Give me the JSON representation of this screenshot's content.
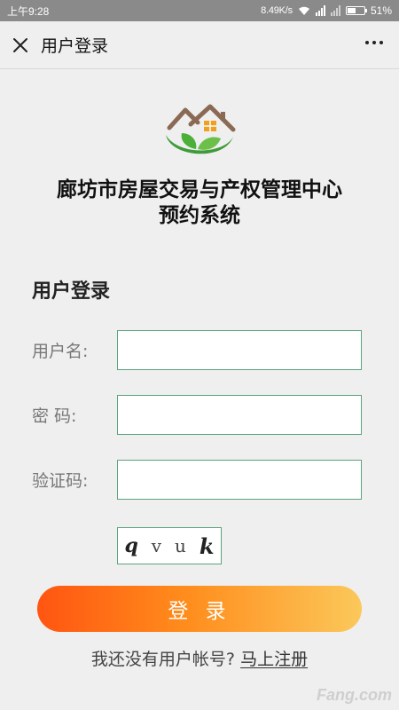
{
  "status_bar": {
    "time": "上午9:28",
    "network_speed": "8.49K/s",
    "battery_percent": "51%",
    "battery_level": 0.51
  },
  "title_bar": {
    "title": "用户登录",
    "close_icon": "close-icon",
    "more_icon": "more-dots-icon"
  },
  "app": {
    "title_line1": "廊坊市房屋交易与产权管理中心",
    "title_line2": "预约系统"
  },
  "login_form": {
    "heading": "用户登录",
    "username_label": "用户名:",
    "username_value": "",
    "password_label": "密 码:",
    "password_value": "",
    "captcha_label": "验证码:",
    "captcha_value": "",
    "captcha_chars": [
      "q",
      "v",
      "u",
      "k"
    ],
    "submit_label": "登 录"
  },
  "register": {
    "prompt": "我还没有用户帐号?",
    "link_label": "马上注册"
  },
  "watermark": "Fang.com",
  "colors": {
    "input_border": "#5aa37f",
    "button_gradient_start": "#ff5511",
    "button_gradient_end": "#fbc85a",
    "logo_green": "#4caf3a",
    "roof_brown": "#8b6a55",
    "window_orange": "#f0a020"
  }
}
